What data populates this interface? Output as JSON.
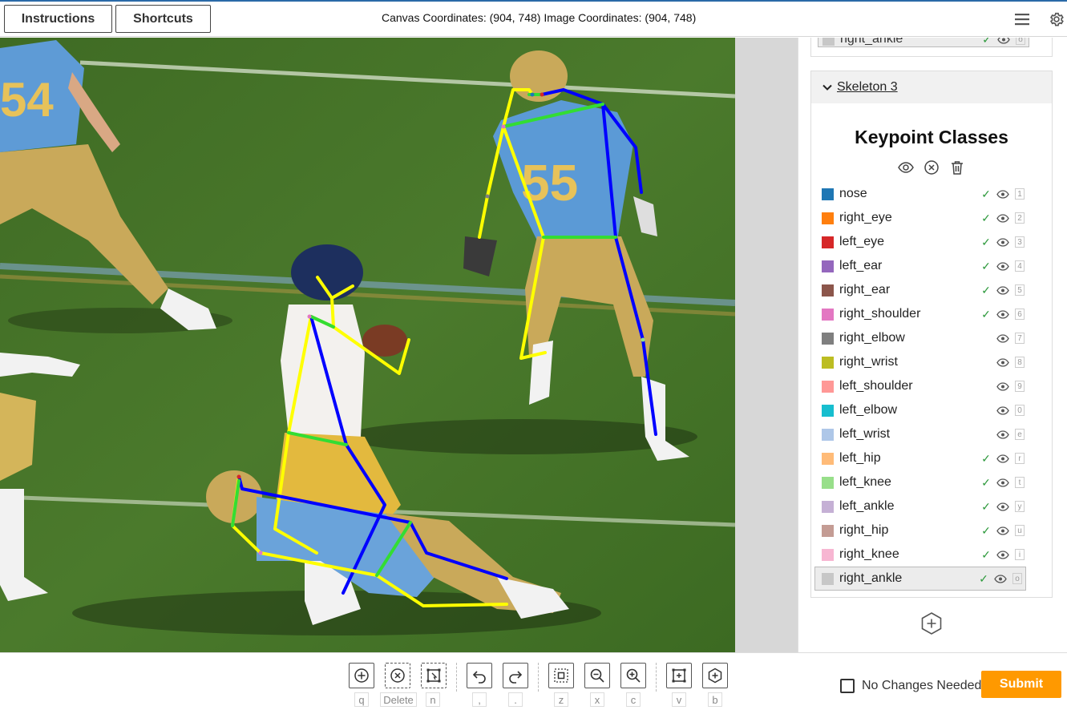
{
  "header": {
    "instructions_label": "Instructions",
    "shortcuts_label": "Shortcuts",
    "coordinates_text": "Canvas Coordinates: (904, 748) Image Coordinates: (904, 748)",
    "menu_icon": "hamburger-menu-icon",
    "settings_icon": "gear-icon"
  },
  "panel": {
    "previous_skeleton_last_row": {
      "label": "right_ankle",
      "color": "#c7c7c7",
      "check": "✓",
      "key": "o"
    },
    "skeleton": {
      "title": "Skeleton 3",
      "section_heading": "Keypoint Classes",
      "tool_icons": [
        "eye-icon",
        "close-circle-icon",
        "trash-icon"
      ],
      "keypoints": [
        {
          "label": "nose",
          "color": "#1f77b4",
          "check": "✓",
          "key": "1"
        },
        {
          "label": "right_eye",
          "color": "#ff7f0e",
          "check": "✓",
          "key": "2"
        },
        {
          "label": "left_eye",
          "color": "#d62728",
          "check": "✓",
          "key": "3"
        },
        {
          "label": "left_ear",
          "color": "#9467bd",
          "check": "✓",
          "key": "4"
        },
        {
          "label": "right_ear",
          "color": "#8c564b",
          "check": "✓",
          "key": "5"
        },
        {
          "label": "right_shoulder",
          "color": "#e377c2",
          "check": "✓",
          "key": "6"
        },
        {
          "label": "right_elbow",
          "color": "#7f7f7f",
          "check": "",
          "key": "7"
        },
        {
          "label": "right_wrist",
          "color": "#bcbd22",
          "check": "",
          "key": "8"
        },
        {
          "label": "left_shoulder",
          "color": "#ff9896",
          "check": "",
          "key": "9"
        },
        {
          "label": "left_elbow",
          "color": "#17becf",
          "check": "",
          "key": "0"
        },
        {
          "label": "left_wrist",
          "color": "#aec7e8",
          "check": "",
          "key": "e"
        },
        {
          "label": "left_hip",
          "color": "#ffbb78",
          "check": "✓",
          "key": "r"
        },
        {
          "label": "left_knee",
          "color": "#98df8a",
          "check": "✓",
          "key": "t"
        },
        {
          "label": "left_ankle",
          "color": "#c5b0d5",
          "check": "✓",
          "key": "y"
        },
        {
          "label": "right_hip",
          "color": "#c49c94",
          "check": "✓",
          "key": "u"
        },
        {
          "label": "right_knee",
          "color": "#f7b6d2",
          "check": "✓",
          "key": "i"
        },
        {
          "label": "right_ankle",
          "color": "#c7c7c7",
          "check": "✓",
          "key": "o",
          "selected": true
        }
      ]
    },
    "add_skeleton_icon": "plus-hexagon-icon"
  },
  "toolbar": {
    "tools": [
      {
        "icon": "add-point-icon",
        "key": "q"
      },
      {
        "icon": "delete-point-icon",
        "key": "Delete"
      },
      {
        "icon": "select-box-icon",
        "key": "n"
      },
      {
        "icon": "undo-icon",
        "key": ","
      },
      {
        "icon": "redo-icon",
        "key": "."
      },
      {
        "icon": "fit-screen-icon",
        "key": "z"
      },
      {
        "icon": "zoom-out-icon",
        "key": "x"
      },
      {
        "icon": "zoom-in-icon",
        "key": "c"
      },
      {
        "icon": "bounding-box-icon",
        "key": "v"
      },
      {
        "icon": "add-skeleton-icon",
        "key": "b"
      }
    ],
    "no_changes_label": "No Changes Needed",
    "submit_label": "Submit",
    "submit_color": "#ff9900"
  },
  "colors": {
    "skeleton_left": "#ffff00",
    "skeleton_right": "#0000ff",
    "skeleton_center": "#33dd33",
    "accent": "#2a6aa8"
  }
}
